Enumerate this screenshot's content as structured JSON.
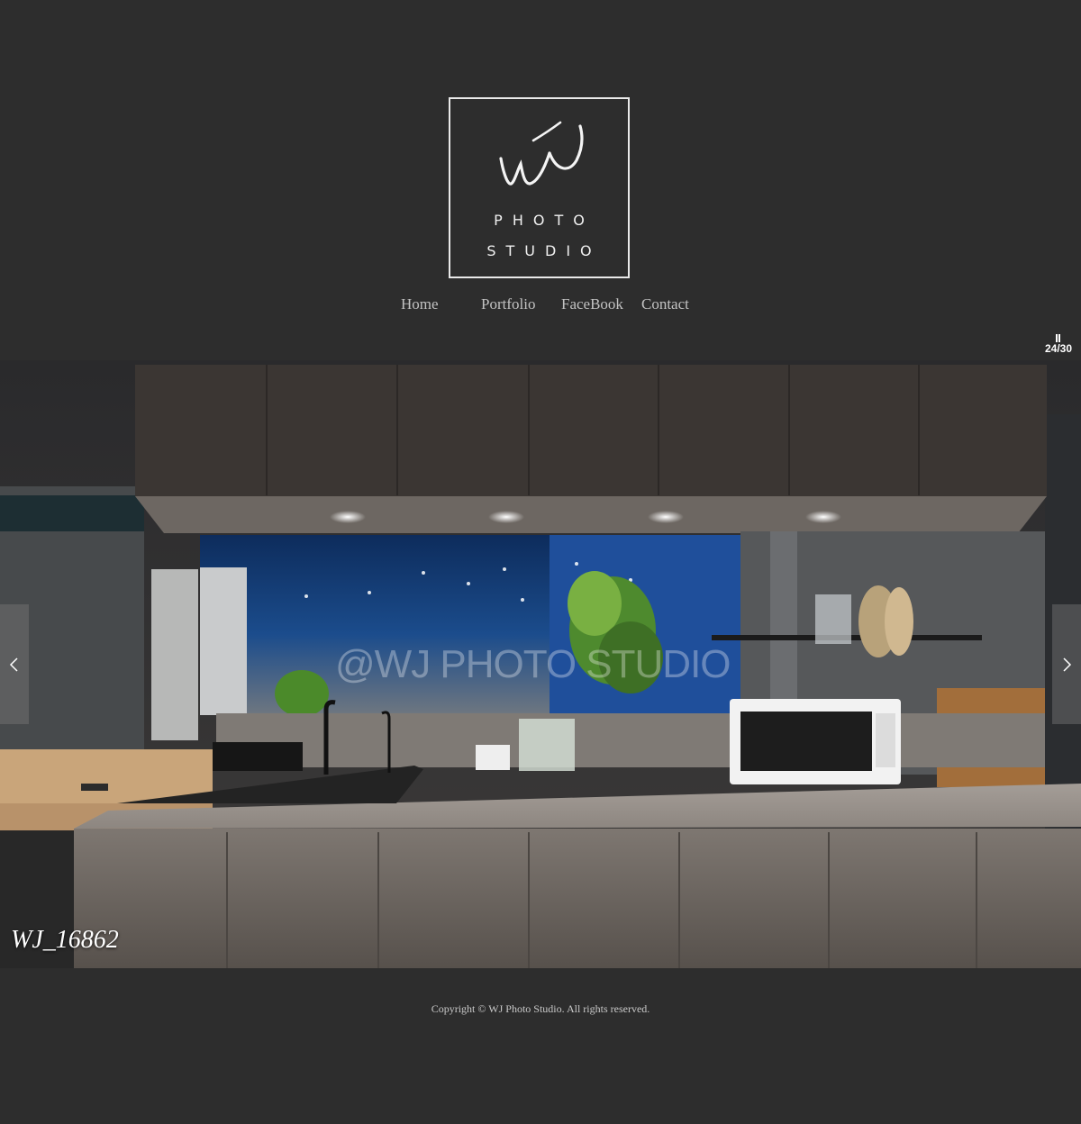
{
  "logo": {
    "line1": "PHOTO",
    "line2": "STUDIO",
    "mark_icon": "wj-signature-logo",
    "border_color": "#e9e9e9"
  },
  "nav": {
    "items": [
      {
        "label": "Home"
      },
      {
        "label": "Portfolio"
      },
      {
        "label": "FaceBook"
      },
      {
        "label": "Contact"
      }
    ]
  },
  "slideshow": {
    "counter": "24/30",
    "pause_icon": "pause-icon",
    "watermark": "@WJ PHOTO STUDIO",
    "caption": "WJ_16862",
    "prev_icon": "chevron-left-icon",
    "next_icon": "chevron-right-icon"
  },
  "footer": {
    "copyright": "Copyright © WJ Photo Studio. All rights reserved."
  },
  "colors": {
    "background": "#2d2d2d",
    "nav_text": "#c2c2c2",
    "caption_text": "#ffffff"
  }
}
